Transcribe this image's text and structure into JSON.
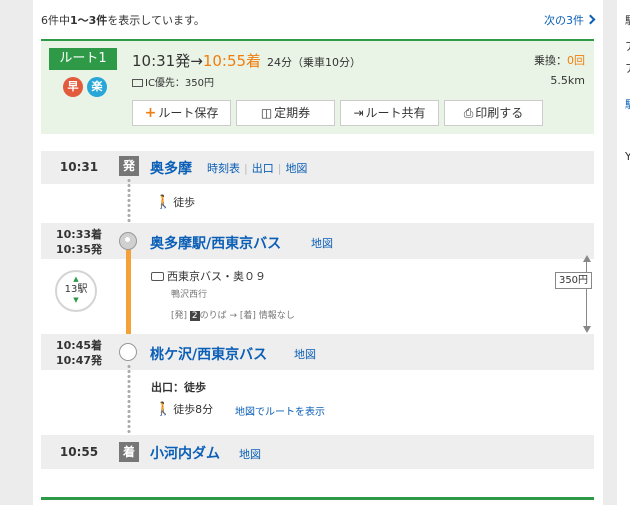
{
  "results": {
    "count_prefix": "6件中",
    "count_range": "1～3件",
    "count_suffix": "を表示しています。",
    "next_label": "次の3件"
  },
  "route": {
    "badge": "ルート1",
    "icon_fast": "早",
    "icon_cheap": "楽",
    "dep_time": "10:31発",
    "arrow": "→",
    "arr_time": "10:55着",
    "duration": "24分（乗車10分）",
    "ic_fare": "IC優先：350円",
    "transfer_label": "乗換：",
    "transfer_count": "0回",
    "distance": "5.5km",
    "buttons": {
      "save": "ルート保存",
      "pass": "定期券",
      "share": "ルート共有",
      "print": "印刷する"
    }
  },
  "stations": [
    {
      "time": "10:31",
      "tag": "発",
      "name": "奥多摩",
      "links": [
        "時刻表",
        "出口",
        "地図"
      ]
    },
    {
      "time_arr": "10:33着",
      "time_dep": "10:35発",
      "name": "奥多摩駅/西東京バス",
      "links": [
        "地図"
      ]
    },
    {
      "time_arr": "10:45着",
      "time_dep": "10:47発",
      "name": "桃ケ沢/西東京バス",
      "links": [
        "地図"
      ]
    },
    {
      "time": "10:55",
      "tag": "着",
      "name": "小河内ダム",
      "links": [
        "地図"
      ]
    }
  ],
  "walk1": "徒歩",
  "bus": {
    "line": "西東京バス・奥０９",
    "direction": "鴨沢西行",
    "platform_dep": "[発]",
    "platform_num": "2",
    "platform_rest": "のりば → [着] 情報なし",
    "stops": "13駅",
    "fare": "350円"
  },
  "exit_label": "出口：徒歩",
  "walk2": "徒歩8分",
  "walk2_link": "地図でルートを表示",
  "right_panel": [
    "駅",
    "ア",
    "ア",
    "駅",
    "Y"
  ],
  "colors": {
    "accent_green": "#2e9a47",
    "accent_orange": "#f07e0e",
    "link_blue": "#0b5fb6"
  },
  "icons": [
    "walk-icon",
    "bus-icon",
    "ic-card-icon",
    "plus-icon",
    "pass-icon",
    "share-icon",
    "print-icon",
    "chevron-right-icon"
  ]
}
